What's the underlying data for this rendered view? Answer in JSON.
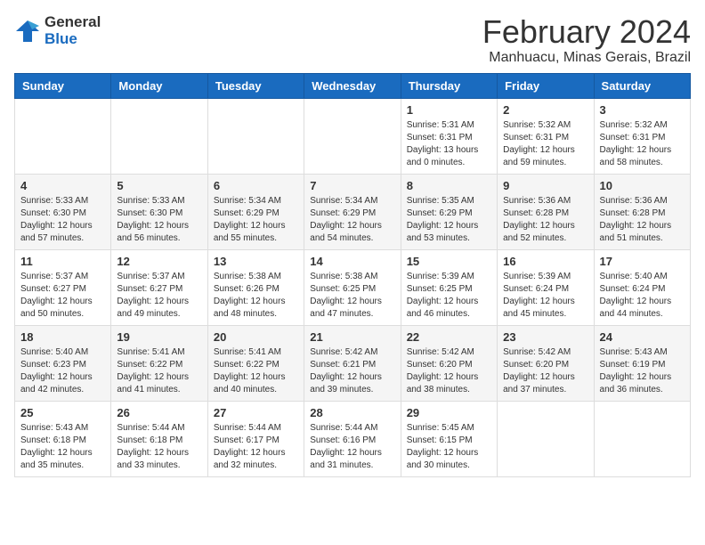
{
  "header": {
    "logo_line1": "General",
    "logo_line2": "Blue",
    "month_title": "February 2024",
    "location": "Manhuacu, Minas Gerais, Brazil"
  },
  "days_of_week": [
    "Sunday",
    "Monday",
    "Tuesday",
    "Wednesday",
    "Thursday",
    "Friday",
    "Saturday"
  ],
  "weeks": [
    [
      {
        "day": "",
        "info": ""
      },
      {
        "day": "",
        "info": ""
      },
      {
        "day": "",
        "info": ""
      },
      {
        "day": "",
        "info": ""
      },
      {
        "day": "1",
        "info": "Sunrise: 5:31 AM\nSunset: 6:31 PM\nDaylight: 13 hours\nand 0 minutes."
      },
      {
        "day": "2",
        "info": "Sunrise: 5:32 AM\nSunset: 6:31 PM\nDaylight: 12 hours\nand 59 minutes."
      },
      {
        "day": "3",
        "info": "Sunrise: 5:32 AM\nSunset: 6:31 PM\nDaylight: 12 hours\nand 58 minutes."
      }
    ],
    [
      {
        "day": "4",
        "info": "Sunrise: 5:33 AM\nSunset: 6:30 PM\nDaylight: 12 hours\nand 57 minutes."
      },
      {
        "day": "5",
        "info": "Sunrise: 5:33 AM\nSunset: 6:30 PM\nDaylight: 12 hours\nand 56 minutes."
      },
      {
        "day": "6",
        "info": "Sunrise: 5:34 AM\nSunset: 6:29 PM\nDaylight: 12 hours\nand 55 minutes."
      },
      {
        "day": "7",
        "info": "Sunrise: 5:34 AM\nSunset: 6:29 PM\nDaylight: 12 hours\nand 54 minutes."
      },
      {
        "day": "8",
        "info": "Sunrise: 5:35 AM\nSunset: 6:29 PM\nDaylight: 12 hours\nand 53 minutes."
      },
      {
        "day": "9",
        "info": "Sunrise: 5:36 AM\nSunset: 6:28 PM\nDaylight: 12 hours\nand 52 minutes."
      },
      {
        "day": "10",
        "info": "Sunrise: 5:36 AM\nSunset: 6:28 PM\nDaylight: 12 hours\nand 51 minutes."
      }
    ],
    [
      {
        "day": "11",
        "info": "Sunrise: 5:37 AM\nSunset: 6:27 PM\nDaylight: 12 hours\nand 50 minutes."
      },
      {
        "day": "12",
        "info": "Sunrise: 5:37 AM\nSunset: 6:27 PM\nDaylight: 12 hours\nand 49 minutes."
      },
      {
        "day": "13",
        "info": "Sunrise: 5:38 AM\nSunset: 6:26 PM\nDaylight: 12 hours\nand 48 minutes."
      },
      {
        "day": "14",
        "info": "Sunrise: 5:38 AM\nSunset: 6:25 PM\nDaylight: 12 hours\nand 47 minutes."
      },
      {
        "day": "15",
        "info": "Sunrise: 5:39 AM\nSunset: 6:25 PM\nDaylight: 12 hours\nand 46 minutes."
      },
      {
        "day": "16",
        "info": "Sunrise: 5:39 AM\nSunset: 6:24 PM\nDaylight: 12 hours\nand 45 minutes."
      },
      {
        "day": "17",
        "info": "Sunrise: 5:40 AM\nSunset: 6:24 PM\nDaylight: 12 hours\nand 44 minutes."
      }
    ],
    [
      {
        "day": "18",
        "info": "Sunrise: 5:40 AM\nSunset: 6:23 PM\nDaylight: 12 hours\nand 42 minutes."
      },
      {
        "day": "19",
        "info": "Sunrise: 5:41 AM\nSunset: 6:22 PM\nDaylight: 12 hours\nand 41 minutes."
      },
      {
        "day": "20",
        "info": "Sunrise: 5:41 AM\nSunset: 6:22 PM\nDaylight: 12 hours\nand 40 minutes."
      },
      {
        "day": "21",
        "info": "Sunrise: 5:42 AM\nSunset: 6:21 PM\nDaylight: 12 hours\nand 39 minutes."
      },
      {
        "day": "22",
        "info": "Sunrise: 5:42 AM\nSunset: 6:20 PM\nDaylight: 12 hours\nand 38 minutes."
      },
      {
        "day": "23",
        "info": "Sunrise: 5:42 AM\nSunset: 6:20 PM\nDaylight: 12 hours\nand 37 minutes."
      },
      {
        "day": "24",
        "info": "Sunrise: 5:43 AM\nSunset: 6:19 PM\nDaylight: 12 hours\nand 36 minutes."
      }
    ],
    [
      {
        "day": "25",
        "info": "Sunrise: 5:43 AM\nSunset: 6:18 PM\nDaylight: 12 hours\nand 35 minutes."
      },
      {
        "day": "26",
        "info": "Sunrise: 5:44 AM\nSunset: 6:18 PM\nDaylight: 12 hours\nand 33 minutes."
      },
      {
        "day": "27",
        "info": "Sunrise: 5:44 AM\nSunset: 6:17 PM\nDaylight: 12 hours\nand 32 minutes."
      },
      {
        "day": "28",
        "info": "Sunrise: 5:44 AM\nSunset: 6:16 PM\nDaylight: 12 hours\nand 31 minutes."
      },
      {
        "day": "29",
        "info": "Sunrise: 5:45 AM\nSunset: 6:15 PM\nDaylight: 12 hours\nand 30 minutes."
      },
      {
        "day": "",
        "info": ""
      },
      {
        "day": "",
        "info": ""
      }
    ]
  ]
}
